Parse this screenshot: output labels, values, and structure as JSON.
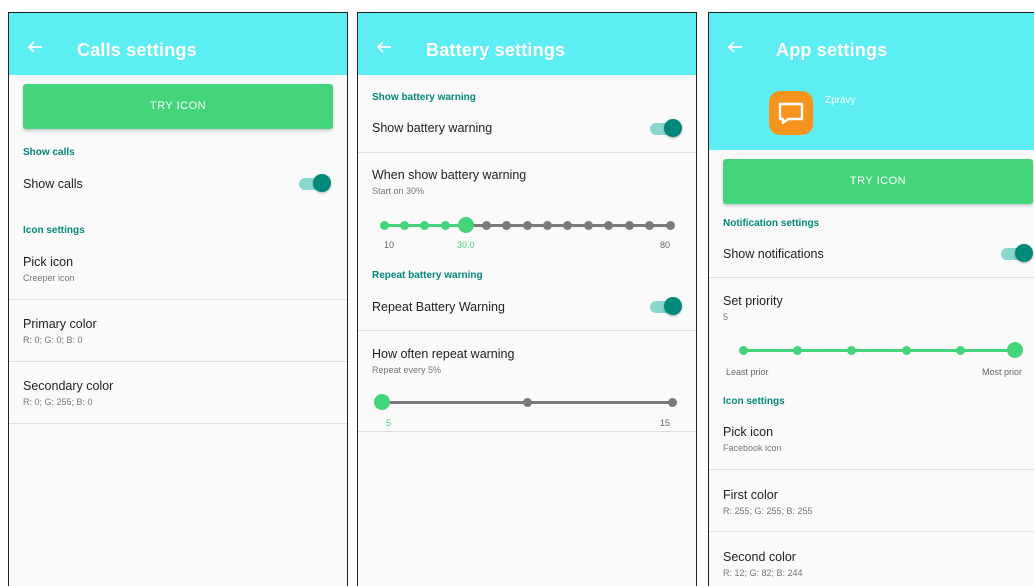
{
  "calls": {
    "title": "Calls settings",
    "try_icon": "TRY ICON",
    "section_show_calls": "Show calls",
    "show_calls_label": "Show calls",
    "section_icon": "Icon settings",
    "pick_icon_label": "Pick icon",
    "pick_icon_value": "Creeper icon",
    "primary_label": "Primary color",
    "primary_value": "R: 0; G: 0; B: 0",
    "secondary_label": "Secondary color",
    "secondary_value": "R: 0; G: 255; B: 0"
  },
  "battery": {
    "title": "Battery settings",
    "section_warning": "Show battery warning",
    "show_warning_label": "Show battery warning",
    "when_label": "When show battery warning",
    "when_sub": "Start on 30%",
    "when_min": "10",
    "when_value": "30.0",
    "when_max": "80",
    "when_slider": {
      "min": 10,
      "max": 80,
      "step": 5,
      "value": 30
    },
    "section_repeat": "Repeat battery warning",
    "repeat_label": "Repeat Battery Warning",
    "often_label": "How often repeat warning",
    "often_sub": "Repeat every 5%",
    "often_min": "5",
    "often_max": "15",
    "often_slider": {
      "min": 5,
      "max": 15,
      "step": 5,
      "value": 5
    }
  },
  "app": {
    "title": "App settings",
    "app_name": "Zprávy",
    "try_icon": "TRY ICON",
    "section_notif": "Notification settings",
    "show_notif_label": "Show notifications",
    "priority_label": "Set priority",
    "priority_value": "5",
    "priority_slider": {
      "min": 0,
      "max": 5,
      "step": 1,
      "value": 5
    },
    "least": "Least prior",
    "most": "Most prior",
    "section_icon": "Icon settings",
    "pick_icon_label": "Pick icon",
    "pick_icon_value": "Facebook icon",
    "first_label": "First color",
    "first_value": "R: 255; G: 255; B: 255",
    "second_label": "Second color",
    "second_value": "R: 12; G: 82; B: 244"
  },
  "colors": {
    "header": "#5deef4",
    "accent": "#00897b",
    "button": "#44d47a",
    "inactive": "#7a7a7a"
  }
}
